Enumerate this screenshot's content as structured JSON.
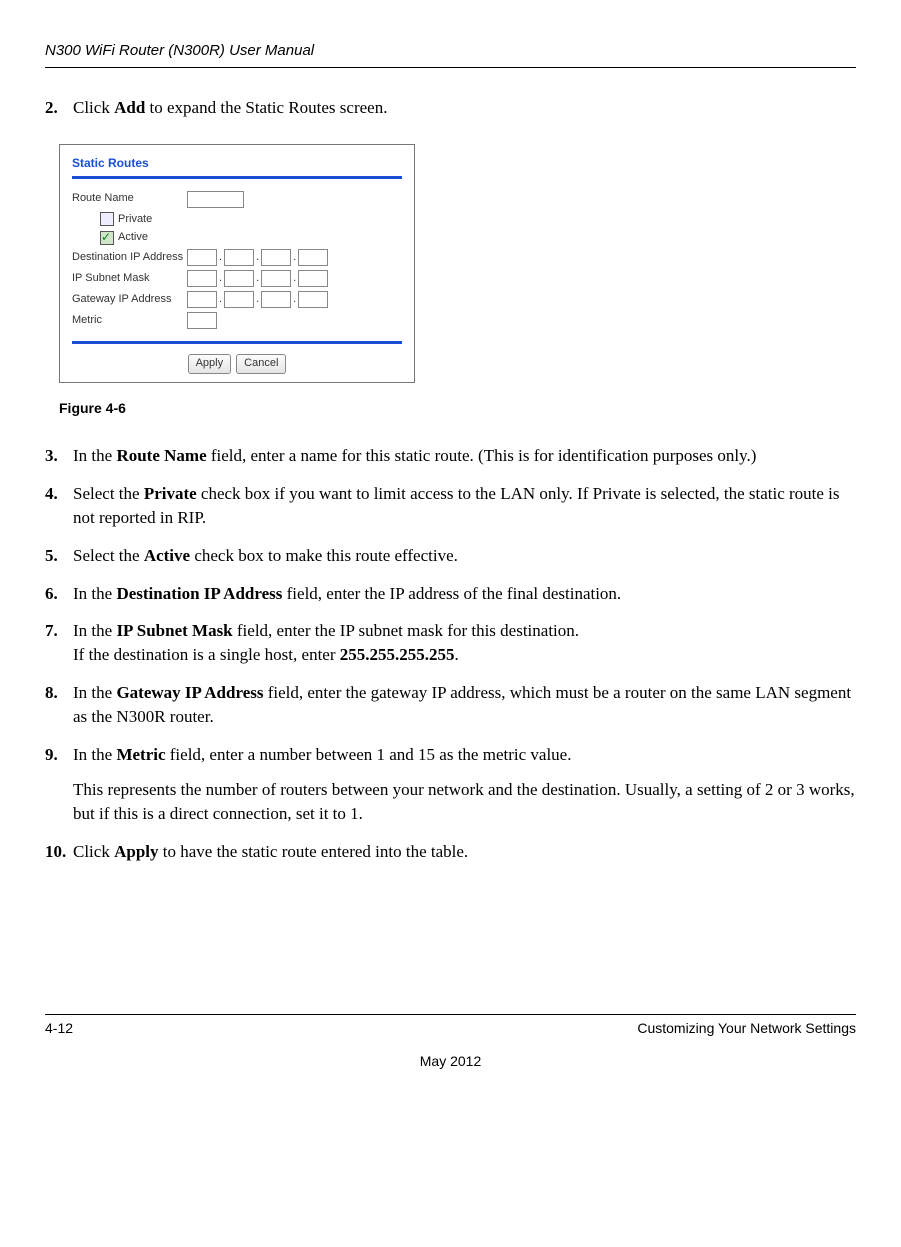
{
  "header": {
    "title": "N300 WiFi Router (N300R) User Manual"
  },
  "step2": {
    "num": "2.",
    "pre": "Click ",
    "bold": "Add",
    "post": " to expand the Static Routes screen."
  },
  "figure": {
    "title": "Static Routes",
    "routeNameLabel": "Route Name",
    "privateLabel": "Private",
    "activeLabel": "Active",
    "destIpLabel": "Destination IP Address",
    "subnetLabel": "IP Subnet Mask",
    "gatewayLabel": "Gateway IP Address",
    "metricLabel": "Metric",
    "applyBtn": "Apply",
    "cancelBtn": "Cancel",
    "caption": "Figure 4-6"
  },
  "step3": {
    "num": "3.",
    "pre": "In the ",
    "bold": "Route Name",
    "post": " field, enter a name for this static route. (This is for identification purposes only.)"
  },
  "step4": {
    "num": "4.",
    "pre": "Select the ",
    "bold": "Private",
    "post": " check box if you want to limit access to the LAN only. If Private is selected, the static route is not reported in RIP."
  },
  "step5": {
    "num": "5.",
    "pre": "Select the ",
    "bold": "Active",
    "post": " check box to make this route effective."
  },
  "step6": {
    "num": "6.",
    "pre": "In the ",
    "bold": "Destination IP Address",
    "post": " field, enter the IP address of the final destination."
  },
  "step7": {
    "num": "7.",
    "pre": "In the ",
    "bold": "IP Subnet Mask",
    "post1": " field, enter the IP subnet mask for this destination.",
    "post2a": "If the destination is a single host, enter ",
    "bold2": "255.255.255.255",
    "post2b": "."
  },
  "step8": {
    "num": "8.",
    "pre": "In the ",
    "bold": "Gateway IP Address",
    "post": " field, enter the gateway IP address, which must be a router on the same LAN segment as the N300R router."
  },
  "step9": {
    "num": "9.",
    "pre": "In the ",
    "bold": "Metric",
    "post": " field, enter a number between 1 and 15 as the metric value.",
    "para2": "This represents the number of routers between your network and the destination. Usually, a setting of 2 or 3 works, but if this is a direct connection, set it to 1."
  },
  "step10": {
    "num": "10.",
    "pre": "Click ",
    "bold": "Apply",
    "post": " to have the static route entered into the table."
  },
  "footer": {
    "pageNum": "4-12",
    "section": "Customizing Your Network Settings",
    "date": "May 2012"
  }
}
